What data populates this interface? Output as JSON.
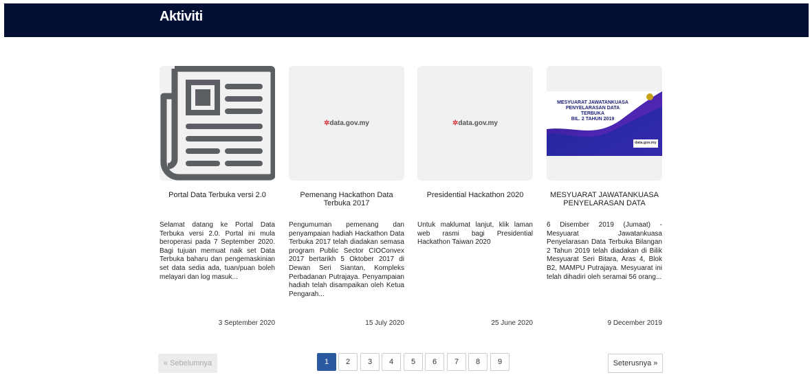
{
  "header": {
    "title": "Aktiviti"
  },
  "cards": [
    {
      "title": "Portal Data Terbuka versi 2.0",
      "image": "newspaper-icon",
      "description": "Selamat datang ke Portal Data Terbuka versi 2.0. Portal ini mula beroperasi pada 7 September 2020.   Bagi tujuan memuat naik set Data Terbuka baharu dan pengemaskinian set data sedia ada, tuan/puan boleh melayari dan log masuk...",
      "date": "3 September 2020"
    },
    {
      "title": "Pemenang Hackathon Data Terbuka 2017",
      "image": "data-gov-logo",
      "logo_text": "data.gov.my",
      "description": "Pengumuman pemenang dan penyampaian hadiah Hackathon Data Terbuka 2017 telah diadakan semasa program Public Sector CIOConvex 2017 bertarikh 5 Oktober 2017 di Dewan Seri Siantan, Kompleks Perbadanan Putrajaya. Penyampaian hadiah telah disampaikan oleh Ketua Pengarah...",
      "date": "15 July 2020"
    },
    {
      "title": "Presidential Hackathon 2020",
      "image": "data-gov-logo",
      "logo_text": "data.gov.my",
      "description": "Untuk maklumat lanjut, klik laman web rasmi bagi Presidential Hackathon Taiwan 2020",
      "date": "25 June 2020"
    },
    {
      "title": "MESYUARAT JAWATANKUASA PENYELARASAN DATA TERBUKA BIL. 2 TAHUN 2019",
      "image": "meeting-banner",
      "banner_lines": [
        "MESYUARAT JAWATANKUASA",
        "PENYELARASAN DATA",
        "TERBUKA",
        "BIL. 2 TAHUN 2019"
      ],
      "banner_logo": "data.gov.my",
      "description": "6 Disember 2019 (Jumaat) - Mesyuarat Jawatankuasa Penyelarasan Data Terbuka Bilangan 2 Tahun 2019 telah diadakan di Bilik Mesyuarat Seri Bitara, Aras 4, Blok B2, MAMPU Putrajaya. Mesyuarat ini telah dihadiri oleh seramai 56 orang...",
      "date": "9 December 2019"
    }
  ],
  "pagination": {
    "prev_label": "« Sebelumnya",
    "next_label": "Seterusnya »",
    "pages": [
      "1",
      "2",
      "3",
      "4",
      "5",
      "6",
      "7",
      "8",
      "9"
    ],
    "current": "1"
  },
  "colors": {
    "header_bg": "#020f35",
    "active_page": "#2b5aa0",
    "logo_accent": "#d9363e"
  }
}
